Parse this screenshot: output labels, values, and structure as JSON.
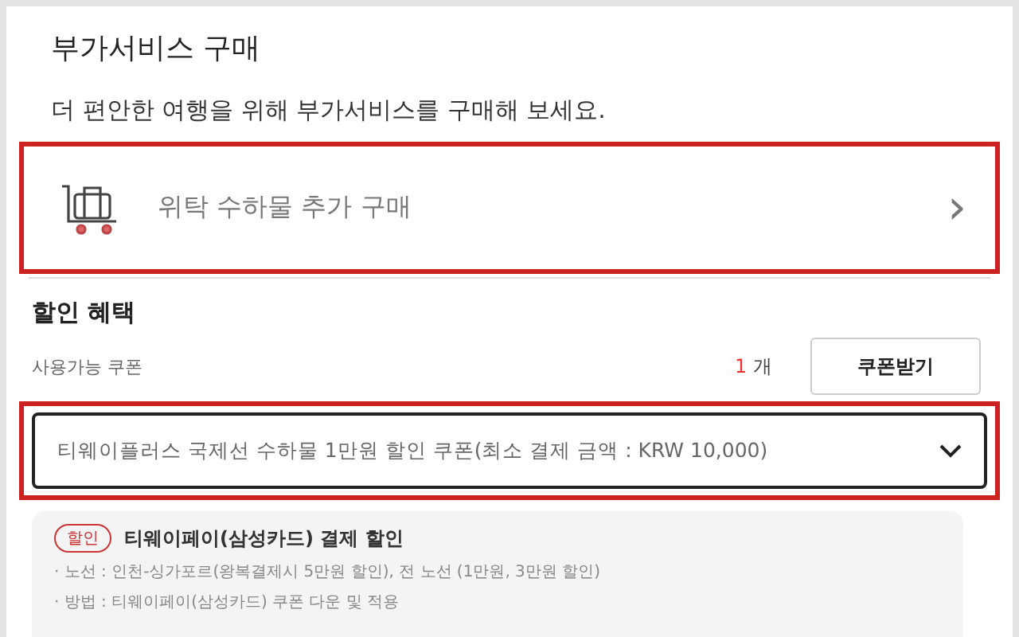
{
  "title": "부가서비스 구매",
  "subtitle": "더 편안한 여행을 위해 부가서비스를 구매해 보세요.",
  "service_item": {
    "label": "위탁 수하물 추가 구매",
    "chevron": "›",
    "highlighted": true
  },
  "discount": {
    "heading": "할인 혜택",
    "coupon_label": "사용가능 쿠폰",
    "coupon_count": "1",
    "count_unit": "개",
    "coupon_button": "쿠폰받기",
    "coupon_select": {
      "value": "티웨이플러스 국제선 수하물 1만원 할인 쿠폰(최소 결제 금액 : KRW 10,000)",
      "highlighted": true
    },
    "promo": {
      "tag": "할인",
      "title": "티웨이페이(삼성카드) 결제 할인",
      "lines": [
        "· 노선 : 인천-싱가포르(왕복결제시 5만원 할인), 전 노선 (1만원, 3만원 할인)",
        "· 방법 : 티웨이페이(삼성카드) 쿠폰 다운 및 적용"
      ]
    }
  }
}
